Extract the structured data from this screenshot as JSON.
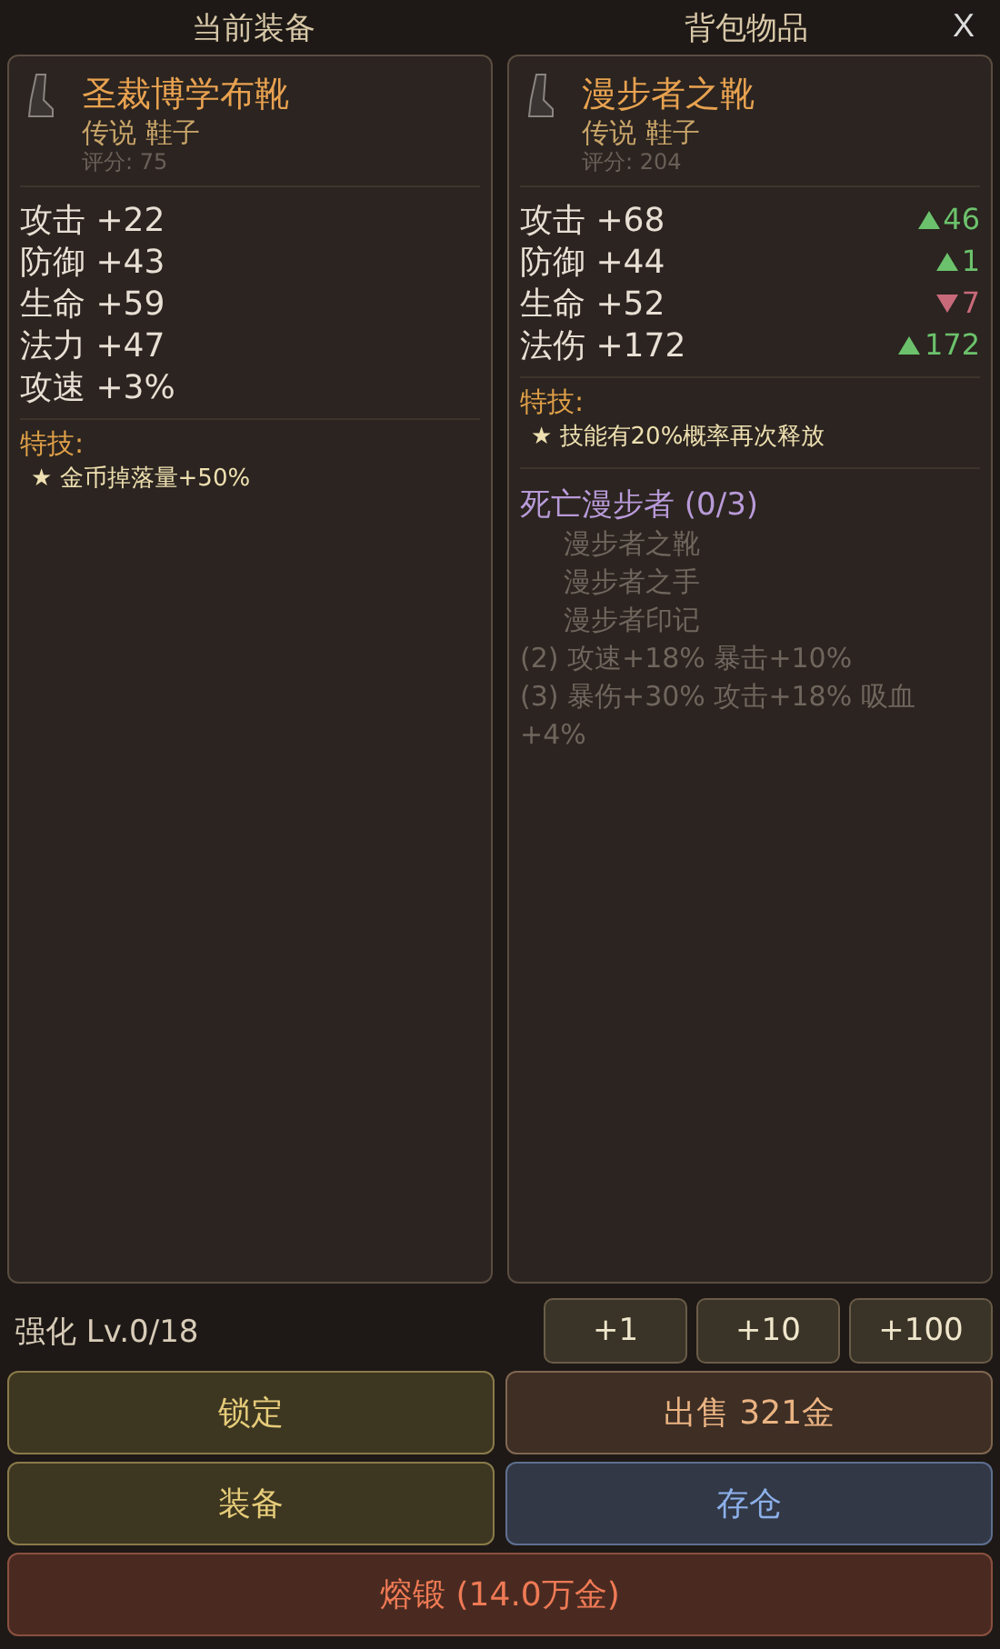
{
  "header": {
    "left_title": "当前装备",
    "right_title": "背包物品",
    "close": "X"
  },
  "panels": [
    {
      "name": "圣裁博学布靴",
      "type": "传说 鞋子",
      "score": "评分: 75",
      "stats": [
        {
          "text": "攻击 +22"
        },
        {
          "text": "防御 +43"
        },
        {
          "text": "生命 +59"
        },
        {
          "text": "法力 +47"
        },
        {
          "text": "攻速 +3%"
        }
      ],
      "skill_title": "特技:",
      "skills": [
        "★ 金币掉落量+50%"
      ]
    },
    {
      "name": "漫步者之靴",
      "type": "传说 鞋子",
      "score": "评分: 204",
      "stats": [
        {
          "text": "攻击 +68",
          "diff": {
            "kind": "up",
            "value": "46"
          }
        },
        {
          "text": "防御 +44",
          "diff": {
            "kind": "up",
            "value": "1"
          }
        },
        {
          "text": "生命 +52",
          "diff": {
            "kind": "down",
            "value": "7"
          }
        },
        {
          "text": "法伤 +172",
          "diff": {
            "kind": "up",
            "value": "172"
          }
        }
      ],
      "skill_title": "特技:",
      "skills": [
        "★ 技能有20%概率再次释放"
      ],
      "set": {
        "title": "死亡漫步者 (0/3)",
        "pieces": [
          "漫步者之靴",
          "漫步者之手",
          "漫步者印记"
        ],
        "bonuses": [
          "(2) 攻速+18% 暴击+10%",
          "(3) 暴伤+30% 攻击+18% 吸血+4%"
        ]
      }
    }
  ],
  "enhance": {
    "label": "强化 Lv.0/18",
    "steps": [
      "+1",
      "+10",
      "+100"
    ]
  },
  "actions": [
    {
      "label": "锁定",
      "kind": "gold"
    },
    {
      "label": "出售 321金",
      "kind": "brown"
    },
    {
      "label": "装备",
      "kind": "gold"
    },
    {
      "label": "存仓",
      "kind": "blue"
    },
    {
      "label": "熔锻 (14.0万金)",
      "kind": "red",
      "wide": true
    }
  ]
}
